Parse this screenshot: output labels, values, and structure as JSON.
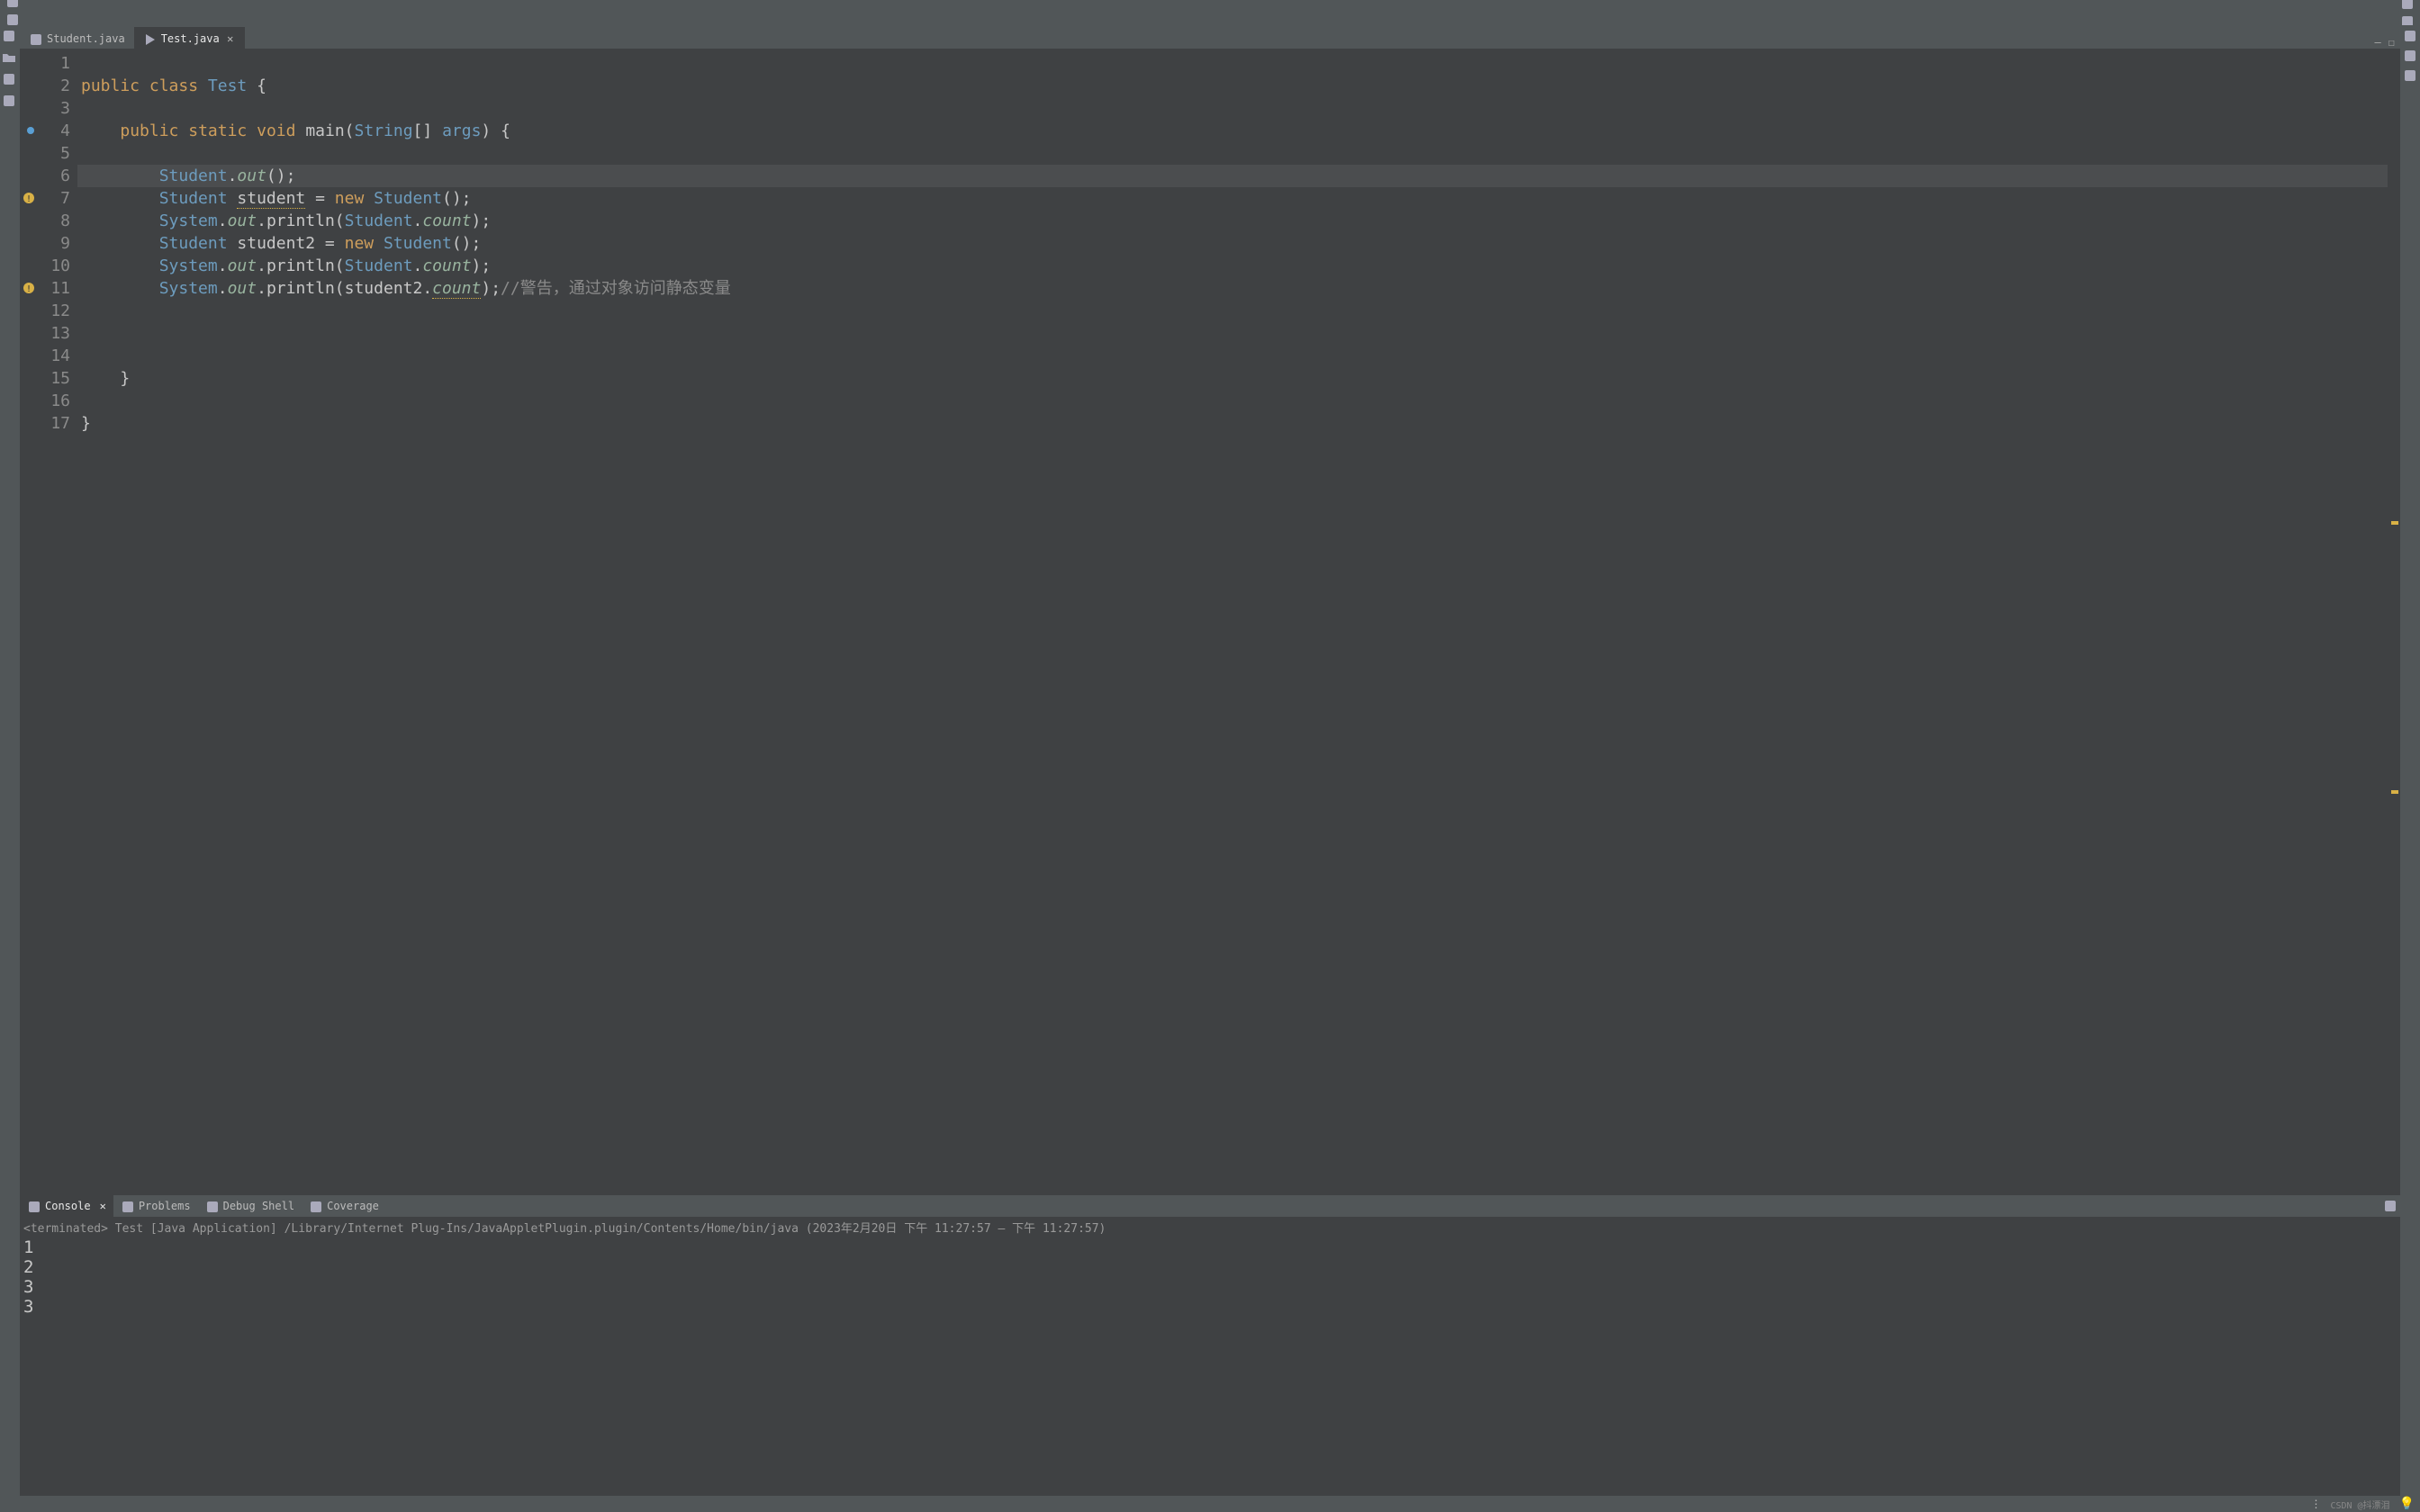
{
  "tabs": [
    {
      "label": "Student.java",
      "active": false,
      "icon": "java-file-icon"
    },
    {
      "label": "Test.java",
      "active": true,
      "icon": "java-run-file-icon"
    }
  ],
  "code": {
    "line_count": 17,
    "current_line": 6,
    "breakpoint_line": 4,
    "warning_lines": [
      7,
      11
    ],
    "lines": [
      {
        "n": 1,
        "seg": []
      },
      {
        "n": 2,
        "seg": [
          {
            "t": "public",
            "c": "t-kw"
          },
          {
            "t": " "
          },
          {
            "t": "class",
            "c": "t-kw"
          },
          {
            "t": " "
          },
          {
            "t": "Test",
            "c": "t-type"
          },
          {
            "t": " {"
          }
        ]
      },
      {
        "n": 3,
        "seg": []
      },
      {
        "n": 4,
        "seg": [
          {
            "t": "    "
          },
          {
            "t": "public",
            "c": "t-kw"
          },
          {
            "t": " "
          },
          {
            "t": "static",
            "c": "t-kw"
          },
          {
            "t": " "
          },
          {
            "t": "void",
            "c": "t-kw"
          },
          {
            "t": " "
          },
          {
            "t": "main",
            "c": "t-func"
          },
          {
            "t": "("
          },
          {
            "t": "String",
            "c": "t-type"
          },
          {
            "t": "[] "
          },
          {
            "t": "args",
            "c": "t-type"
          },
          {
            "t": ") {"
          }
        ]
      },
      {
        "n": 5,
        "seg": []
      },
      {
        "n": 6,
        "seg": [
          {
            "t": "        "
          },
          {
            "t": "Student",
            "c": "t-type"
          },
          {
            "t": "."
          },
          {
            "t": "out",
            "c": "t-field"
          },
          {
            "t": "();"
          }
        ]
      },
      {
        "n": 7,
        "seg": [
          {
            "t": "        "
          },
          {
            "t": "Student",
            "c": "t-type"
          },
          {
            "t": " "
          },
          {
            "t": "student",
            "c": "t-warn"
          },
          {
            "t": " = "
          },
          {
            "t": "new",
            "c": "t-kw"
          },
          {
            "t": " "
          },
          {
            "t": "Student",
            "c": "t-type"
          },
          {
            "t": "();"
          }
        ]
      },
      {
        "n": 8,
        "seg": [
          {
            "t": "        "
          },
          {
            "t": "System",
            "c": "t-type"
          },
          {
            "t": "."
          },
          {
            "t": "out",
            "c": "t-field"
          },
          {
            "t": "."
          },
          {
            "t": "println",
            "c": "t-func"
          },
          {
            "t": "("
          },
          {
            "t": "Student",
            "c": "t-type"
          },
          {
            "t": "."
          },
          {
            "t": "count",
            "c": "t-field"
          },
          {
            "t": ");"
          }
        ]
      },
      {
        "n": 9,
        "seg": [
          {
            "t": "        "
          },
          {
            "t": "Student",
            "c": "t-type"
          },
          {
            "t": " student2 = "
          },
          {
            "t": "new",
            "c": "t-kw"
          },
          {
            "t": " "
          },
          {
            "t": "Student",
            "c": "t-type"
          },
          {
            "t": "();"
          }
        ]
      },
      {
        "n": 10,
        "seg": [
          {
            "t": "        "
          },
          {
            "t": "System",
            "c": "t-type"
          },
          {
            "t": "."
          },
          {
            "t": "out",
            "c": "t-field"
          },
          {
            "t": "."
          },
          {
            "t": "println",
            "c": "t-func"
          },
          {
            "t": "("
          },
          {
            "t": "Student",
            "c": "t-type"
          },
          {
            "t": "."
          },
          {
            "t": "count",
            "c": "t-field"
          },
          {
            "t": ");"
          }
        ]
      },
      {
        "n": 11,
        "seg": [
          {
            "t": "        "
          },
          {
            "t": "System",
            "c": "t-type"
          },
          {
            "t": "."
          },
          {
            "t": "out",
            "c": "t-field"
          },
          {
            "t": "."
          },
          {
            "t": "println",
            "c": "t-func"
          },
          {
            "t": "("
          },
          {
            "t": "student2",
            "c": ""
          },
          {
            "t": "."
          },
          {
            "t": "count",
            "c": "t-field t-warn"
          },
          {
            "t": ");"
          },
          {
            "t": "//警告，通过对象访问静态变量",
            "c": "t-cmt"
          }
        ]
      },
      {
        "n": 12,
        "seg": []
      },
      {
        "n": 13,
        "seg": []
      },
      {
        "n": 14,
        "seg": []
      },
      {
        "n": 15,
        "seg": [
          {
            "t": "    }"
          }
        ]
      },
      {
        "n": 16,
        "seg": []
      },
      {
        "n": 17,
        "seg": [
          {
            "t": "}"
          }
        ]
      }
    ]
  },
  "bottom_tabs": [
    {
      "label": "Console",
      "icon": "console-icon",
      "active": true,
      "closable": true
    },
    {
      "label": "Problems",
      "icon": "problems-icon",
      "active": false,
      "closable": false
    },
    {
      "label": "Debug Shell",
      "icon": "debug-shell-icon",
      "active": false,
      "closable": false
    },
    {
      "label": "Coverage",
      "icon": "coverage-icon",
      "active": false,
      "closable": false
    }
  ],
  "console": {
    "header": "<terminated> Test [Java Application] /Library/Internet Plug-Ins/JavaAppletPlugin.plugin/Contents/Home/bin/java  (2023年2月20日 下午 11:27:57 – 下午 11:27:57)",
    "output": "1\n2\n3\n3"
  },
  "toolbar_icons": [
    "new-file-icon",
    "save-icon",
    "save-all-icon",
    "properties-icon",
    "inspect-icon",
    "sep",
    "resume-icon",
    "pause-icon",
    "stop-icon",
    "disconnect-icon",
    "step-into-icon",
    "step-over-icon",
    "step-return-icon",
    "drop-frame-icon",
    "sep",
    "expressions-icon",
    "variables-icon",
    "breakpoints-icon",
    "skip-breakpoints-icon",
    "toggle-mark-icon",
    "bookmark-icon",
    "task-icon",
    "paragraph-icon",
    "sep",
    "paint-icon",
    "sep",
    "run-icon",
    "debug-icon",
    "profile-icon",
    "sep",
    "open-folder-icon",
    "package-icon",
    "pen-icon",
    "sep",
    "outline-icon",
    "type-hierarchy-icon",
    "sep",
    "back-nav-icon",
    "forward-nav-icon",
    "back-icon",
    "forward-icon",
    "sep",
    "custom-icon"
  ],
  "right_toolbar_icons": [
    "search-icon",
    "open-perspective-icon",
    "plugins-icon",
    "team-icon",
    "random-icon",
    "java-perspective-icon"
  ],
  "left_stripe_icons": [
    "type-hierarchy-side-icon",
    "package-explorer-icon",
    "git-icon",
    "junit-icon"
  ],
  "right_stripe_icons": [
    "minimap-icon",
    "breakpoint-side-icon",
    "link-icon"
  ],
  "console_toolbar_icons": [
    "minimize-icon",
    "close-console-icon",
    "clear-console-icon",
    "pin-icon",
    "display-icon",
    "scroll-lock-icon",
    "word-wrap-icon",
    "show-console-icon",
    "remove-launch-icon",
    "remove-all-icon",
    "open-console-icon",
    "min-view-icon",
    "max-view-icon"
  ],
  "watermark": "CSDN @抖漂泪",
  "colors": {
    "bg": "#3f4143",
    "panel": "#515658",
    "kw": "#ce9e5c",
    "type": "#6d9cbe",
    "field": "#99b49f",
    "cmt": "#8a8a8a",
    "warn": "#d9b146"
  }
}
